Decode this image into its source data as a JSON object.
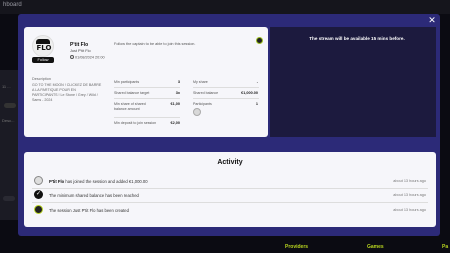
{
  "background": {
    "title": "hboard",
    "left_label_a": "11 ...",
    "left_label_b": "Desc...",
    "nav": [
      "Providers",
      "Games",
      "Pa"
    ]
  },
  "modal": {
    "close_label": "✕",
    "streamer": {
      "logo_text": "FLO",
      "follow_label": "Follow",
      "name": "P'tit Flo",
      "subtitle": "Just P'tit Flo",
      "date": "01/08/2024 20:00",
      "follow_note": "Follow the captain to be able to join this session."
    },
    "description": {
      "label": "Description",
      "text": "GO TO THE MOON ! CLICKEZ DE BARRE A LA PARTIQUE POUR EN PARTICIPANTS ! Le Stone / Grey / Wild / Sams - 2024"
    },
    "details_left": [
      {
        "label": "Min participants",
        "value": "3"
      },
      {
        "label": "Shared balance target",
        "value": "3x"
      },
      {
        "label": "Min share of shared balance amount",
        "value": "€1,00"
      },
      {
        "label": "Min deposit to join session",
        "value": "€2,00"
      }
    ],
    "details_right": [
      {
        "label": "My share",
        "value": "-"
      },
      {
        "label": "Shared balance",
        "value": "€1,000.00"
      },
      {
        "label": "Participants",
        "value": "1"
      }
    ],
    "notice": "The stream will be available 15 mins before."
  },
  "activity": {
    "title": "Activity",
    "rows": [
      {
        "actor": "P'tit Flo",
        "text": "has joined the session and added €1,000.00",
        "time": "about 13 hours ago"
      },
      {
        "actor": "",
        "text": "The minimum shared balance has been reached",
        "time": "about 13 hours ago"
      },
      {
        "actor": "",
        "text": "The session Just P'tit Flo has been created",
        "time": "about 13 hours ago"
      }
    ]
  },
  "colors": {
    "modal_bg": "#2c2a78",
    "accent_lime": "#b7d31f"
  }
}
